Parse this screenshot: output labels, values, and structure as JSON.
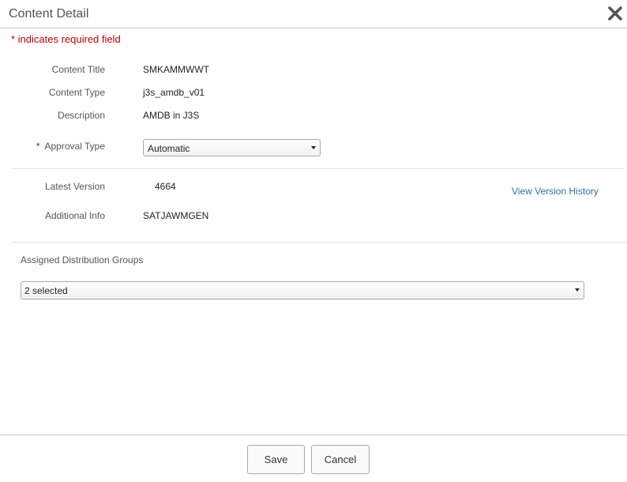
{
  "dialog": {
    "title": "Content Detail",
    "close_icon": "close-icon",
    "required_note": "* indicates required field"
  },
  "fields": {
    "content_title": {
      "label": "Content Title",
      "value": "SMKAMMWWT"
    },
    "content_type": {
      "label": "Content Type",
      "value": "j3s_amdb_v01"
    },
    "description": {
      "label": "Description",
      "value": "AMDB in J3S"
    },
    "approval_type": {
      "required_marker": "*",
      "label": "Approval Type",
      "selected": "Automatic"
    },
    "latest_version": {
      "label": "Latest Version",
      "value": "4664"
    },
    "additional_info": {
      "label": "Additional Info",
      "value": "SATJAWMGEN"
    }
  },
  "view_version_history": "View Version History",
  "distribution": {
    "label": "Assigned Distribution Groups",
    "selected": "2 selected"
  },
  "footer": {
    "save_label": "Save",
    "cancel_label": "Cancel"
  },
  "colors": {
    "required": "#c00000",
    "link": "#2a6fb0"
  }
}
